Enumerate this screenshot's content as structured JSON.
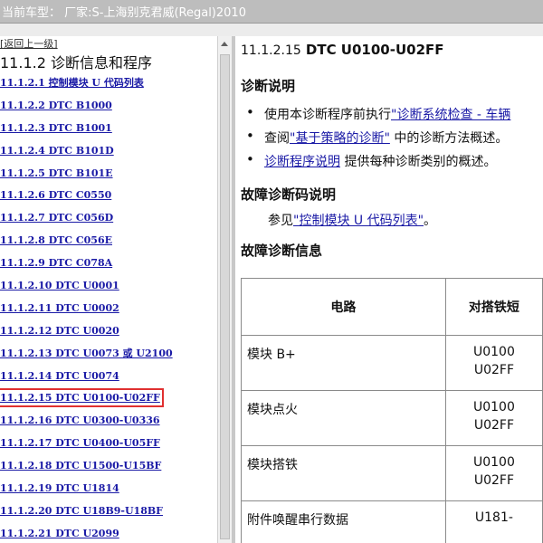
{
  "window": {
    "title": "当前车型：  厂家:S-上海别克君威(Regal)2010"
  },
  "nav": {
    "back_label": "[返回上一级]",
    "heading": "11.1.2 诊断信息和程序",
    "items": [
      {
        "label": "11.1.2.1 控制模块 U 代码列表"
      },
      {
        "label": "11.1.2.2 DTC B1000"
      },
      {
        "label": "11.1.2.3 DTC B1001"
      },
      {
        "label": "11.1.2.4 DTC B101D"
      },
      {
        "label": "11.1.2.5 DTC B101E"
      },
      {
        "label": "11.1.2.6 DTC C0550"
      },
      {
        "label": "11.1.2.7 DTC C056D"
      },
      {
        "label": "11.1.2.8 DTC C056E"
      },
      {
        "label": "11.1.2.9 DTC C078A"
      },
      {
        "label": "11.1.2.10 DTC U0001"
      },
      {
        "label": "11.1.2.11 DTC U0002"
      },
      {
        "label": "11.1.2.12 DTC U0020"
      },
      {
        "label": "11.1.2.13 DTC U0073 或 U2100"
      },
      {
        "label": "11.1.2.14 DTC U0074"
      },
      {
        "label": "11.1.2.15 DTC U0100-U02FF",
        "selected": true
      },
      {
        "label": "11.1.2.16 DTC U0300-U0336"
      },
      {
        "label": "11.1.2.17 DTC U0400-U05FF"
      },
      {
        "label": "11.1.2.18 DTC U1500-U15BF"
      },
      {
        "label": "11.1.2.19 DTC U1814"
      },
      {
        "label": "11.1.2.20 DTC U18B9-U18BF"
      },
      {
        "label": "11.1.2.21 DTC U2099"
      }
    ]
  },
  "content": {
    "section_number": "11.1.2.15",
    "dtc_title": "DTC U0100-U02FF",
    "diag_desc_heading": "诊断说明",
    "bullets": [
      {
        "pre": "使用本诊断程序前执行",
        "link": "\"诊断系统检查 - 车辆",
        "post": ""
      },
      {
        "pre": "查阅",
        "link": "\"基于策略的诊断\"",
        "post": " 中的诊断方法概述。"
      },
      {
        "pre": "",
        "link": "诊断程序说明",
        "post": " 提供每种诊断类别的概述。"
      }
    ],
    "dtc_desc_heading": "故障诊断码说明",
    "dtc_ref_pre": "参见",
    "dtc_ref_link": "\"控制模块 U 代码列表\"",
    "dtc_ref_post": "。",
    "diag_info_heading": "故障诊断信息",
    "table": {
      "headers": [
        "电路",
        "对搭铁短"
      ],
      "rows": [
        {
          "circuit": "模块 B+",
          "code": "U0100\nU02FF"
        },
        {
          "circuit": "模块点火",
          "code": "U0100\nU02FF"
        },
        {
          "circuit": "模块搭铁",
          "code": "U0100\nU02FF"
        },
        {
          "circuit": "附件唤醒串行数据",
          "code": "U181-"
        }
      ]
    }
  }
}
